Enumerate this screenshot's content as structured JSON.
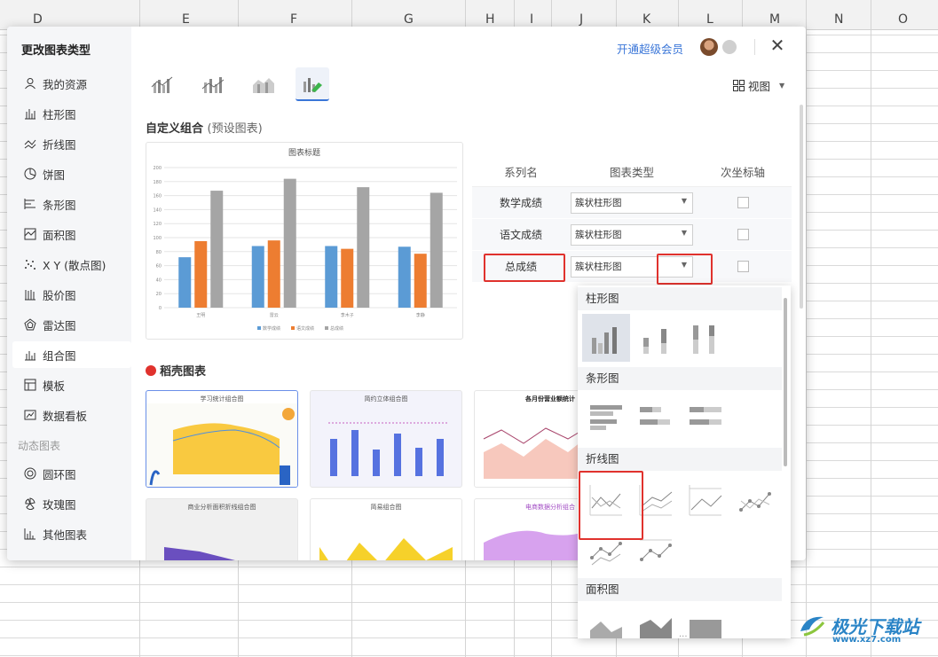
{
  "spreadsheet": {
    "columns": [
      "D",
      "E",
      "F",
      "G",
      "H",
      "I",
      "J",
      "K",
      "L",
      "M",
      "N",
      "O"
    ]
  },
  "dialog": {
    "title": "更改图表类型",
    "vip_link": "开通超级会员",
    "close_label": "✕",
    "view_label": "视图",
    "sidebar": {
      "items": [
        {
          "label": "我的资源",
          "icon": "user-icon"
        },
        {
          "label": "柱形图",
          "icon": "column-chart-icon"
        },
        {
          "label": "折线图",
          "icon": "line-chart-icon"
        },
        {
          "label": "饼图",
          "icon": "pie-chart-icon"
        },
        {
          "label": "条形图",
          "icon": "bar-chart-icon"
        },
        {
          "label": "面积图",
          "icon": "area-chart-icon"
        },
        {
          "label": "X Y (散点图)",
          "icon": "scatter-chart-icon"
        },
        {
          "label": "股价图",
          "icon": "stock-chart-icon"
        },
        {
          "label": "雷达图",
          "icon": "radar-chart-icon"
        },
        {
          "label": "组合图",
          "icon": "combo-chart-icon",
          "active": true
        },
        {
          "label": "模板",
          "icon": "template-icon"
        },
        {
          "label": "数据看板",
          "icon": "dashboard-icon"
        }
      ],
      "group_label": "动态图表",
      "dynamic_items": [
        {
          "label": "圆环图",
          "icon": "donut-chart-icon"
        },
        {
          "label": "玫瑰图",
          "icon": "rose-chart-icon"
        },
        {
          "label": "其他图表",
          "icon": "other-chart-icon"
        }
      ]
    },
    "section_title": "自定义组合",
    "section_sub": "(预设图表)",
    "series_table": {
      "headers": [
        "系列名",
        "图表类型",
        "次坐标轴"
      ],
      "rows": [
        {
          "name": "数学成绩",
          "type": "簇状柱形图",
          "secondary": false
        },
        {
          "name": "语文成绩",
          "type": "簇状柱形图",
          "secondary": false
        },
        {
          "name": "总成绩",
          "type": "簇状柱形图",
          "secondary": false
        }
      ]
    },
    "wps_section_title": "稻壳图表",
    "templates": [
      {
        "title": "学习统计组合图"
      },
      {
        "title": "简约立体组合图"
      },
      {
        "title": "各月份营业额统计"
      },
      {
        "title": "商业分析面积折线组合图"
      },
      {
        "title": "简易组合图"
      },
      {
        "title": "电商数据分析组合"
      }
    ],
    "dropdown": {
      "groups": [
        "柱形图",
        "条形图",
        "折线图",
        "面积图"
      ],
      "more": "..."
    }
  },
  "chart_data": {
    "type": "bar",
    "title": "图表标题",
    "categories": [
      "王明",
      "雷云",
      "李木子",
      "李静"
    ],
    "series": [
      {
        "name": "数学成绩",
        "values": [
          72,
          88,
          88,
          87
        ],
        "color": "#5b9bd5"
      },
      {
        "name": "语文成绩",
        "values": [
          95,
          96,
          84,
          77
        ],
        "color": "#ed7d31"
      },
      {
        "name": "总成绩",
        "values": [
          167,
          184,
          172,
          164
        ],
        "color": "#a5a5a5"
      }
    ],
    "ylim": [
      0,
      200
    ],
    "yticks": [
      0,
      20,
      40,
      60,
      80,
      100,
      120,
      140,
      160,
      180,
      200
    ],
    "legend": "bottom",
    "grid": true
  },
  "watermark": {
    "text": "极光下载站",
    "url": "www.xz7.com"
  }
}
